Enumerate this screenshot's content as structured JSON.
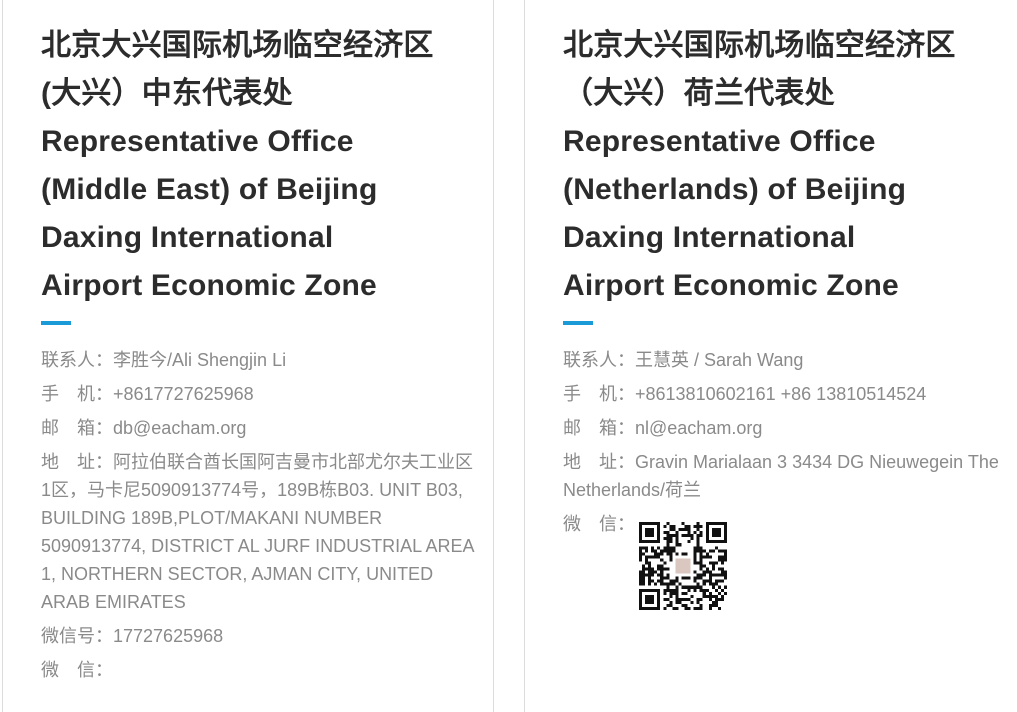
{
  "cards": [
    {
      "title_lines": [
        "北京大兴国际机场临空经济区",
        "(大兴）中东代表处",
        "Representative Office",
        "(Middle East) of Beijing",
        "Daxing International",
        "Airport Economic Zone"
      ],
      "contact": {
        "label": "联系人：",
        "value": "李胜今/Ali Shengjin Li"
      },
      "phone": {
        "label": "手　机：",
        "value": "+8617727625968"
      },
      "email": {
        "label": "邮　箱：",
        "value": "db@eacham.org"
      },
      "address": {
        "label": "地　址：",
        "value": "阿拉伯联合酋长国阿吉曼市北部尤尔夫工业区1区，马卡尼5090913774号，189B栋B03. UNIT B03, BUILDING 189B,PLOT/MAKANI NUMBER 5090913774, DISTRICT AL JURF INDUSTRIAL AREA 1, NORTHERN SECTOR, AJMAN CITY, UNITED ARAB EMIRATES"
      },
      "wechat_id": {
        "label": "微信号：",
        "value": "17727625968"
      },
      "wechat": {
        "label": "微　信："
      }
    },
    {
      "title_lines": [
        "北京大兴国际机场临空经济区",
        "（大兴）荷兰代表处",
        "Representative Office",
        "(Netherlands) of Beijing",
        "Daxing International",
        "Airport Economic Zone"
      ],
      "contact": {
        "label": "联系人：",
        "value": "王慧英 / Sarah Wang"
      },
      "phone": {
        "label": "手　机：",
        "value": "+8613810602161 +86 13810514524"
      },
      "email": {
        "label": "邮　箱：",
        "value": "nl@eacham.org"
      },
      "address": {
        "label": "地　址：",
        "value": "Gravin Marialaan 3 3434 DG Nieuwegein The Netherlands/荷兰"
      },
      "wechat": {
        "label": "微　信："
      }
    }
  ],
  "colors": {
    "accent": "#1a9bd7",
    "title": "#2c2c2c",
    "text": "#8a8a8a",
    "border": "#dcdcdc"
  },
  "icons": {
    "qr": "wechat-qr-code"
  }
}
